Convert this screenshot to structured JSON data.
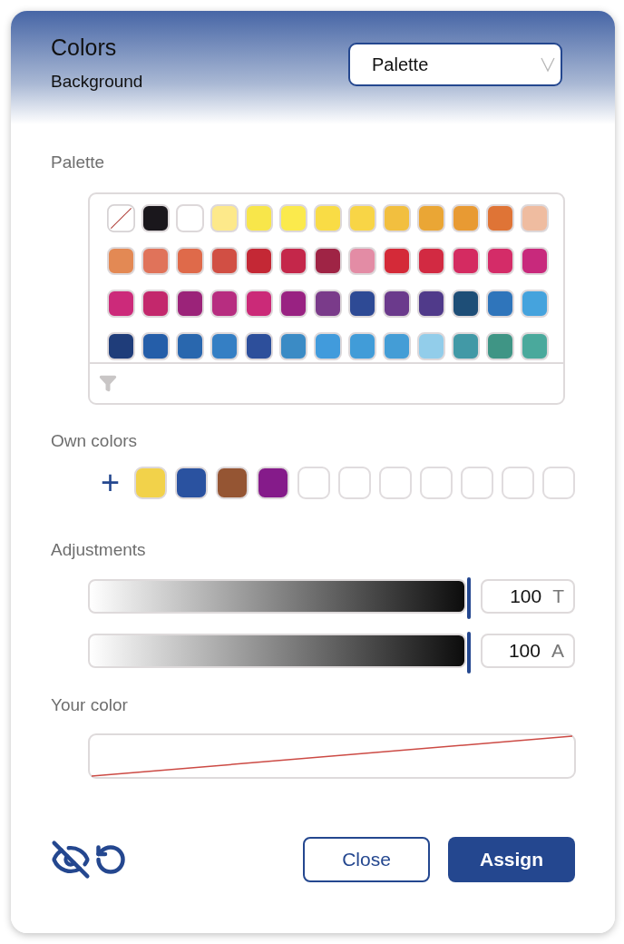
{
  "header": {
    "title": "Colors",
    "subtitle": "Background",
    "mode_select": {
      "value": "Palette"
    }
  },
  "palette": {
    "label": "Palette",
    "swatches": [
      {
        "kind": "none"
      },
      {
        "kind": "color",
        "color": "#1a171c"
      },
      {
        "kind": "color",
        "color": "#ffffff"
      },
      {
        "kind": "color",
        "color": "#fde98a"
      },
      {
        "kind": "color",
        "color": "#f8e64a"
      },
      {
        "kind": "color",
        "color": "#fbea4c"
      },
      {
        "kind": "color",
        "color": "#f9dc45"
      },
      {
        "kind": "color",
        "color": "#f8d546"
      },
      {
        "kind": "color",
        "color": "#f2bf3f"
      },
      {
        "kind": "color",
        "color": "#eaa635"
      },
      {
        "kind": "color",
        "color": "#e89a33"
      },
      {
        "kind": "color",
        "color": "#df7436"
      },
      {
        "kind": "color",
        "color": "#efbca0"
      },
      {
        "kind": "color",
        "color": "#e38954"
      },
      {
        "kind": "color",
        "color": "#e0735a"
      },
      {
        "kind": "color",
        "color": "#df6a4a"
      },
      {
        "kind": "color",
        "color": "#d14f44"
      },
      {
        "kind": "color",
        "color": "#c42835"
      },
      {
        "kind": "color",
        "color": "#c4274a"
      },
      {
        "kind": "color",
        "color": "#9f2445"
      },
      {
        "kind": "color",
        "color": "#e38ca5"
      },
      {
        "kind": "color",
        "color": "#d42a38"
      },
      {
        "kind": "color",
        "color": "#d22a42"
      },
      {
        "kind": "color",
        "color": "#d42b61"
      },
      {
        "kind": "color",
        "color": "#d42c68"
      },
      {
        "kind": "color",
        "color": "#c8297c"
      },
      {
        "kind": "color",
        "color": "#cc2a7a"
      },
      {
        "kind": "color",
        "color": "#c3286c"
      },
      {
        "kind": "color",
        "color": "#9b2379"
      },
      {
        "kind": "color",
        "color": "#b72d80"
      },
      {
        "kind": "color",
        "color": "#cb2a78"
      },
      {
        "kind": "color",
        "color": "#992282"
      },
      {
        "kind": "color",
        "color": "#7a3b8a"
      },
      {
        "kind": "color",
        "color": "#2e4a95"
      },
      {
        "kind": "color",
        "color": "#6b3a8c"
      },
      {
        "kind": "color",
        "color": "#503a8a"
      },
      {
        "kind": "color",
        "color": "#1e4e77"
      },
      {
        "kind": "color",
        "color": "#2f75bb"
      },
      {
        "kind": "color",
        "color": "#45a3dd"
      },
      {
        "kind": "color",
        "color": "#1f3d7a"
      },
      {
        "kind": "color",
        "color": "#255ea9"
      },
      {
        "kind": "color",
        "color": "#2967ae"
      },
      {
        "kind": "color",
        "color": "#357fc4"
      },
      {
        "kind": "color",
        "color": "#2d4f9b"
      },
      {
        "kind": "color",
        "color": "#3b8bc5"
      },
      {
        "kind": "color",
        "color": "#419bdc"
      },
      {
        "kind": "color",
        "color": "#419cd8"
      },
      {
        "kind": "color",
        "color": "#449dd6"
      },
      {
        "kind": "color",
        "color": "#92cdea"
      },
      {
        "kind": "color",
        "color": "#4299a6"
      },
      {
        "kind": "color",
        "color": "#3f9585"
      },
      {
        "kind": "color",
        "color": "#4aa99c"
      }
    ]
  },
  "own_colors": {
    "label": "Own colors",
    "add": "+",
    "slots": [
      {
        "kind": "color",
        "color": "#f2d24a"
      },
      {
        "kind": "color",
        "color": "#2a52a0"
      },
      {
        "kind": "color",
        "color": "#955533"
      },
      {
        "kind": "color",
        "color": "#851b8a"
      },
      {
        "kind": "empty"
      },
      {
        "kind": "empty"
      },
      {
        "kind": "empty"
      },
      {
        "kind": "empty"
      },
      {
        "kind": "empty"
      },
      {
        "kind": "empty"
      },
      {
        "kind": "empty"
      }
    ]
  },
  "adjustments": {
    "label": "Adjustments",
    "sliders": [
      {
        "level": 1,
        "value": "100",
        "unit": "T"
      },
      {
        "level": 1,
        "value": "100",
        "unit": "A"
      }
    ]
  },
  "your_color": {
    "label": "Your color",
    "kind": "none"
  },
  "footer": {
    "buttons": [
      {
        "label": "Close",
        "kind": "secondary"
      },
      {
        "label": "Assign",
        "kind": "primary"
      }
    ]
  }
}
